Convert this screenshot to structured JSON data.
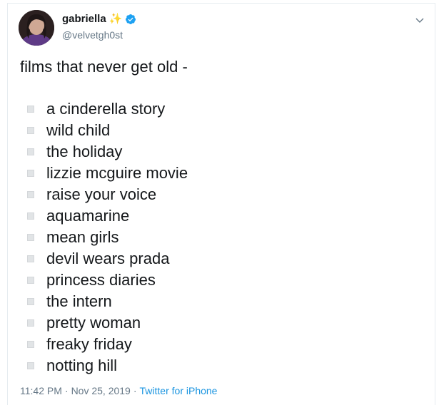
{
  "author": {
    "name": "gabriella",
    "name_emoji": "✨",
    "handle": "@velvetgh0st",
    "verified": true
  },
  "tweet": {
    "text": "films that never get old -",
    "items": [
      "a cinderella story",
      "wild child",
      "the holiday",
      "lizzie mcguire movie",
      "raise your voice",
      "aquamarine",
      "mean girls",
      "devil wears prada",
      "princess diaries",
      "the intern",
      "pretty woman",
      "freaky friday",
      "notting hill"
    ],
    "time": "11:42 PM",
    "separator": "·",
    "date": "Nov 25, 2019",
    "source": "Twitter for iPhone"
  },
  "icons": {
    "verified": "verified-badge-icon",
    "more": "chevron-down-icon",
    "bullet": "checkbox-square-icon"
  },
  "colors": {
    "verified_blue": "#1da1f2",
    "link_blue": "#1b95e0",
    "secondary_text": "#657786",
    "sparkle": "#f4b400"
  }
}
